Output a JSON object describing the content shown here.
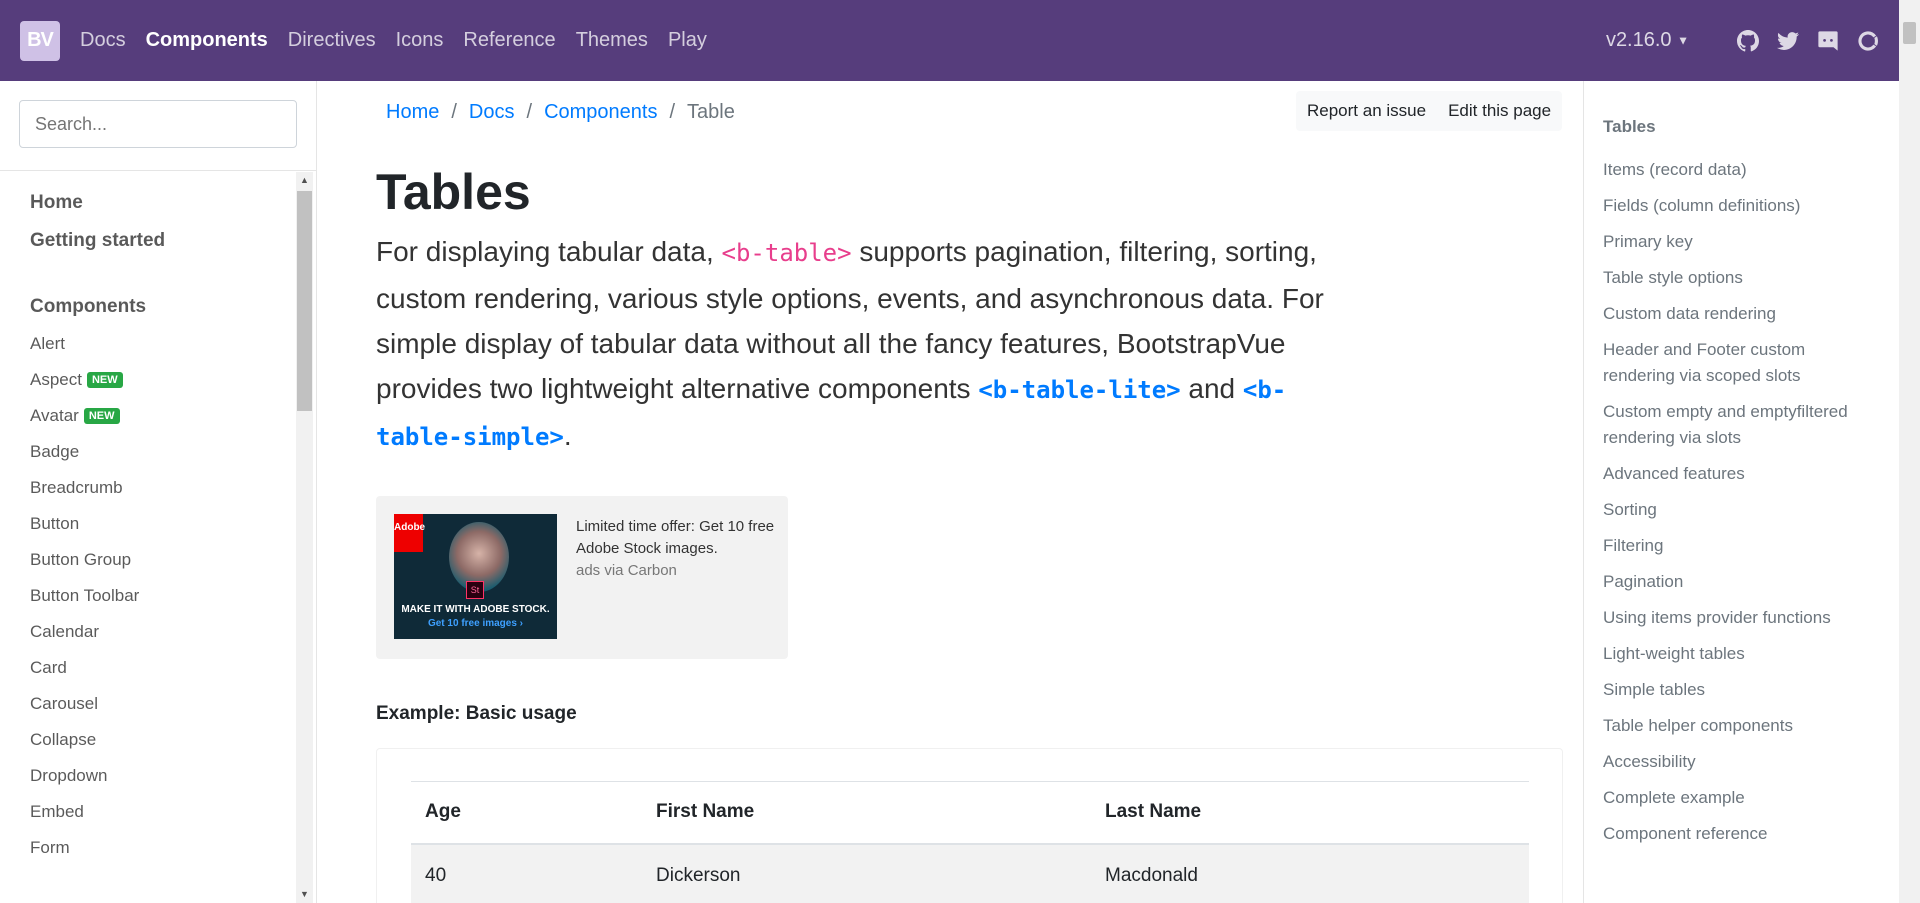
{
  "navbar": {
    "brand": "BV",
    "links": [
      "Docs",
      "Components",
      "Directives",
      "Icons",
      "Reference",
      "Themes",
      "Play"
    ],
    "active_index": 1,
    "version": "v2.16.0",
    "icons": [
      "github-icon",
      "twitter-icon",
      "discord-icon",
      "opencollective-icon"
    ]
  },
  "sidebar": {
    "search_placeholder": "Search...",
    "top_links": [
      "Home",
      "Getting started"
    ],
    "group_title": "Components",
    "items": [
      {
        "label": "Alert",
        "badge": ""
      },
      {
        "label": "Aspect",
        "badge": "NEW"
      },
      {
        "label": "Avatar",
        "badge": "NEW"
      },
      {
        "label": "Badge",
        "badge": ""
      },
      {
        "label": "Breadcrumb",
        "badge": ""
      },
      {
        "label": "Button",
        "badge": ""
      },
      {
        "label": "Button Group",
        "badge": ""
      },
      {
        "label": "Button Toolbar",
        "badge": ""
      },
      {
        "label": "Calendar",
        "badge": ""
      },
      {
        "label": "Card",
        "badge": ""
      },
      {
        "label": "Carousel",
        "badge": ""
      },
      {
        "label": "Collapse",
        "badge": ""
      },
      {
        "label": "Dropdown",
        "badge": ""
      },
      {
        "label": "Embed",
        "badge": ""
      },
      {
        "label": "Form",
        "badge": ""
      }
    ]
  },
  "breadcrumb": {
    "items": [
      "Home",
      "Docs",
      "Components"
    ],
    "current": "Table",
    "separator": "/"
  },
  "actions": {
    "report": "Report an issue",
    "edit": "Edit this page"
  },
  "main": {
    "title": "Tables",
    "lead": {
      "p1": "For displaying tabular data, ",
      "code1": "<b-table>",
      "p2": " supports pagination, filtering, sorting, custom rendering, various style options, events, and asynchronous data. For simple display of tabular data without all the fancy features, BootstrapVue provides two lightweight alternative components ",
      "code2": "<b-table-lite>",
      "p3": " and ",
      "code3": "<b-table-simple>",
      "p4": "."
    },
    "ad": {
      "text": "Limited time offer: Get 10 free Adobe Stock images.",
      "via": "ads via Carbon",
      "logo_text": "Adobe",
      "st": "St",
      "tagline1": "MAKE IT WITH ADOBE STOCK.",
      "tagline2": "Get 10 free images ›"
    },
    "example_label": "Example: Basic usage",
    "table": {
      "columns": [
        "Age",
        "First Name",
        "Last Name"
      ],
      "rows": [
        [
          "40",
          "Dickerson",
          "Macdonald"
        ]
      ]
    }
  },
  "toc": {
    "title": "Tables",
    "items": [
      "Items (record data)",
      "Fields (column definitions)",
      "Primary key",
      "Table style options",
      "Custom data rendering",
      "Header and Footer custom rendering via scoped slots",
      "Custom empty and emptyfiltered rendering via slots",
      "Advanced features",
      "Sorting",
      "Filtering",
      "Pagination",
      "Using items provider functions",
      "Light-weight tables",
      "Simple tables",
      "Table helper components",
      "Accessibility",
      "Complete example",
      "Component reference"
    ]
  },
  "colors": {
    "navbar": "#563d7c",
    "link": "#007bff",
    "code": "#e83e8c",
    "new_badge": "#28a745"
  }
}
